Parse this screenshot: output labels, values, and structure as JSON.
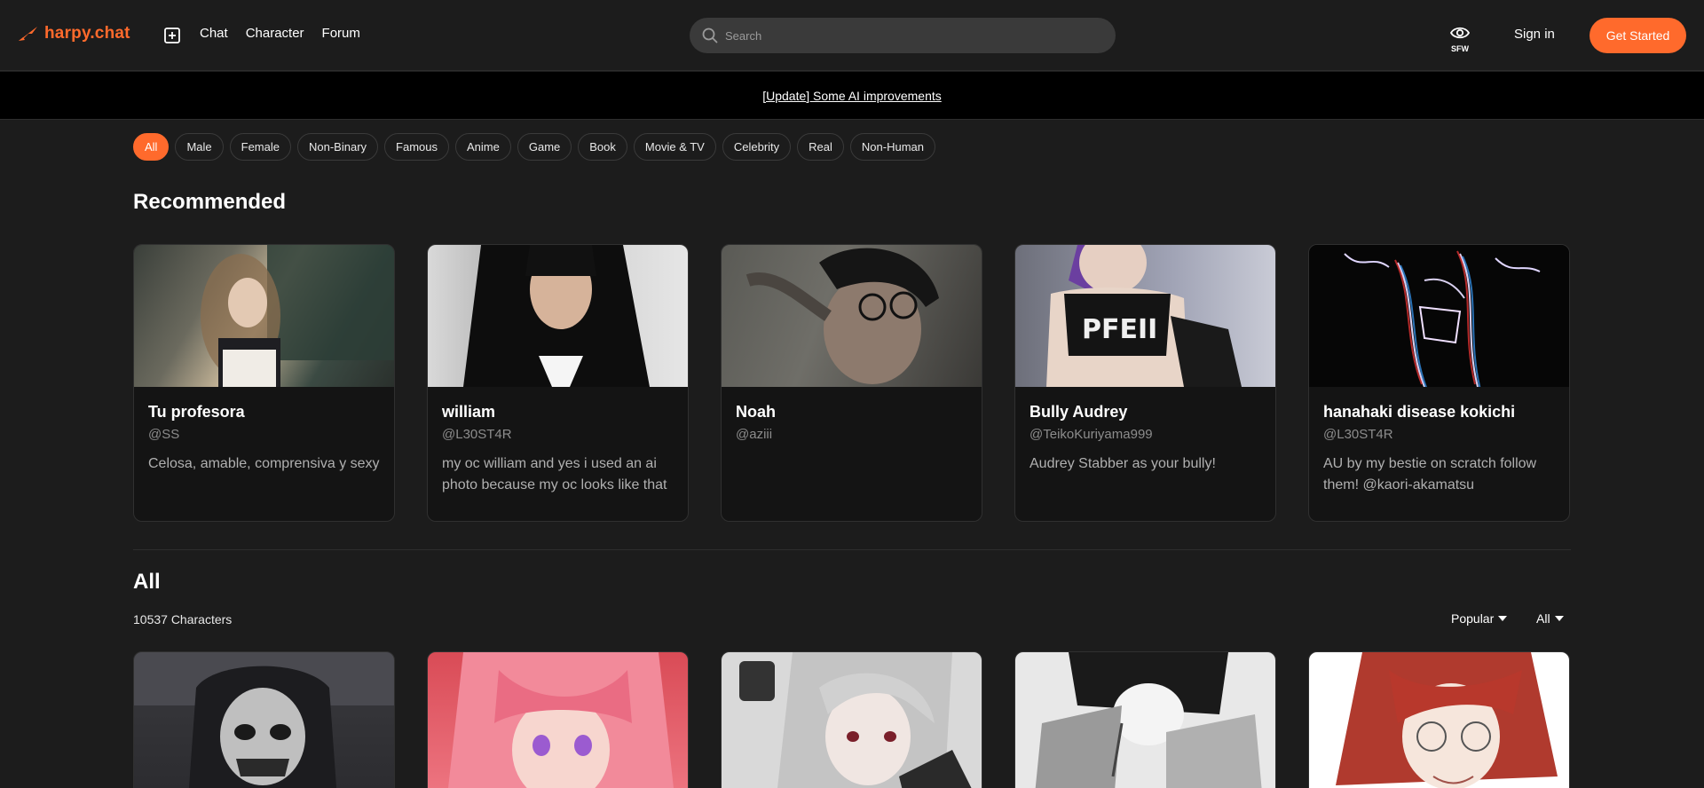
{
  "header": {
    "logo_text": "harpy.chat",
    "nav": [
      "Chat",
      "Character",
      "Forum"
    ],
    "search_placeholder": "Search",
    "sfw_label": "SFW",
    "sign_in": "Sign in",
    "get_started": "Get Started"
  },
  "banner": {
    "text": "[Update] Some AI improvements"
  },
  "filters": [
    "All",
    "Male",
    "Female",
    "Non-Binary",
    "Famous",
    "Anime",
    "Game",
    "Book",
    "Movie & TV",
    "Celebrity",
    "Real",
    "Non-Human"
  ],
  "active_filter": "All",
  "recommended": {
    "title": "Recommended",
    "cards": [
      {
        "name": "Tu profesora",
        "handle": "@SS",
        "desc": "Celosa, amable, comprensiva y sexy"
      },
      {
        "name": "william",
        "handle": "@L30ST4R",
        "desc": "my oc william and yes i used an ai photo because my oc looks like that"
      },
      {
        "name": "Noah",
        "handle": "@aziii",
        "desc": ""
      },
      {
        "name": "Bully Audrey",
        "handle": "@TeikoKuriyama999",
        "desc": "Audrey Stabber as your bully!"
      },
      {
        "name": "hanahaki disease kokichi",
        "handle": "@L30ST4R",
        "desc": "AU by my bestie on scratch follow them! @kaori-akamatsu"
      }
    ]
  },
  "all": {
    "title": "All",
    "count_text": "10537 Characters",
    "sort_label": "Popular",
    "filter_label": "All"
  },
  "colors": {
    "accent": "#ff6a2c",
    "background": "#1c1c1c",
    "card": "#141414",
    "banner": "#000000"
  }
}
